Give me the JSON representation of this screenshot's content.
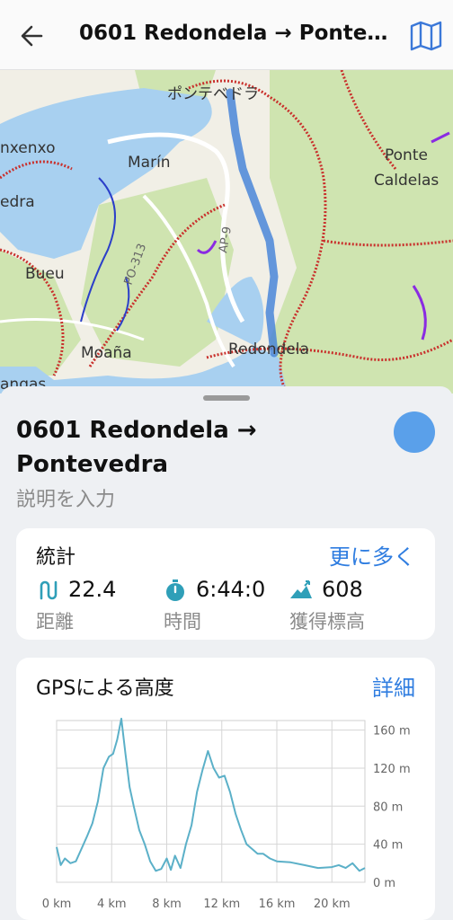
{
  "header": {
    "title": "0601 Redondela → Pontevedra",
    "back_icon": "arrow-left-icon",
    "map_icon": "map-icon"
  },
  "map": {
    "places": {
      "pontevedra": "ポンテベドラ",
      "sanxenxo": "nxenxo",
      "marin": "Marín",
      "ponte_caldelas_1": "Ponte",
      "ponte_caldelas_2": "Caldelas",
      "edra": "edra",
      "bueu": "Bueu",
      "moana": "Moaña",
      "redondela": "Redondela",
      "cangas": "angas",
      "road_pop": "PO-313",
      "road_ap9": "AP-9"
    }
  },
  "route": {
    "name": "0601 Redondela → Pontevedra",
    "description_placeholder": "説明を入力",
    "color": "#5aa0ea"
  },
  "stats": {
    "title": "統計",
    "more": "更に多く",
    "distance": {
      "value": "22.4",
      "label": "距離",
      "icon": "route-icon"
    },
    "time": {
      "value": "6:44:0",
      "label": "時間",
      "icon": "stopwatch-icon"
    },
    "ascent": {
      "value": "608",
      "label": "獲得標高",
      "icon": "ascent-icon"
    }
  },
  "elevation": {
    "title": "GPSによる高度",
    "details": "詳細"
  },
  "chart_data": {
    "type": "line",
    "title": "GPSによる高度",
    "x_ticks": [
      "0 km",
      "4 km",
      "8 km",
      "12 km",
      "16 km",
      "20 km"
    ],
    "y_ticks": [
      "0 m",
      "40 m",
      "80 m",
      "120 m",
      "160 m"
    ],
    "xlim": [
      0,
      22.4
    ],
    "ylim": [
      0,
      170
    ],
    "color": "#5bb0c8",
    "x": [
      0,
      0.3,
      0.6,
      1,
      1.4,
      1.8,
      2.2,
      2.6,
      3,
      3.4,
      3.8,
      4.1,
      4.4,
      4.7,
      5,
      5.3,
      5.6,
      6,
      6.4,
      6.8,
      7.2,
      7.6,
      8,
      8.3,
      8.6,
      9,
      9.4,
      9.8,
      10.2,
      10.6,
      11,
      11.4,
      11.8,
      12.2,
      12.6,
      13,
      13.4,
      13.8,
      14.2,
      14.6,
      15,
      15.5,
      16,
      17,
      18,
      19,
      20,
      20.5,
      21,
      21.5,
      22,
      22.4
    ],
    "y": [
      37,
      18,
      25,
      20,
      22,
      35,
      48,
      62,
      85,
      120,
      132,
      135,
      150,
      172,
      135,
      100,
      80,
      55,
      40,
      22,
      12,
      14,
      25,
      13,
      28,
      15,
      40,
      60,
      95,
      118,
      138,
      120,
      110,
      112,
      95,
      72,
      55,
      40,
      35,
      30,
      30,
      25,
      22,
      21,
      18,
      15,
      16,
      18,
      15,
      20,
      12,
      15
    ]
  }
}
